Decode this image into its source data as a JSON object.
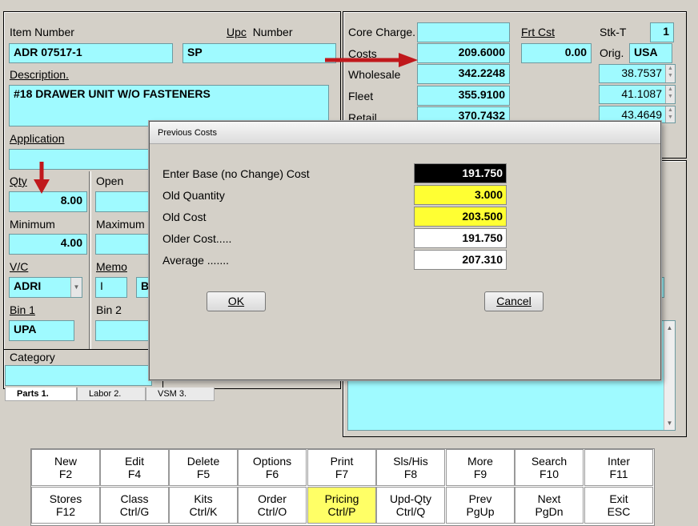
{
  "form": {
    "item_number_label": "Item Number",
    "item_number": "ADR 07517-1",
    "upc_label_a": "Upc",
    "upc_label_b": "Number",
    "upc": "SP",
    "description_label": "Description.",
    "description": "#18 DRAWER UNIT W/O FASTENERS",
    "application_label": "Application",
    "qty_label": "Qty",
    "qty": "8.00",
    "open_label": "Open",
    "minimum_label": "Minimum",
    "minimum": "4.00",
    "maximum_label": "Maximum",
    "vc_label": "V/C",
    "vc": "ADRI",
    "memo_label": "Memo",
    "memo": "I",
    "memo_b": "B",
    "bin1_label": "Bin 1",
    "bin1": "UPA",
    "bin2_label": "Bin 2",
    "category_label": "Category"
  },
  "pricing": {
    "core_charge_label": "Core Charge.",
    "costs_label": "Costs",
    "costs": "209.6000",
    "wholesale_label": "Wholesale",
    "wholesale": "342.2248",
    "fleet_label": "Fleet",
    "fleet": "355.9100",
    "retail_label": "Retail",
    "retail": "370.7432",
    "frt_cst_label": "Frt Cst",
    "frt_cst": "0.00",
    "stkt_label": "Stk-T",
    "stkt": "1",
    "orig_label": "Orig.",
    "orig": "USA",
    "pct1": "38.7537",
    "pct2": "41.1087",
    "pct3": "43.4649"
  },
  "tabs": [
    "Parts 1.",
    "Labor 2.",
    "VSM 3."
  ],
  "dialog": {
    "title": "Previous Costs",
    "rows": [
      {
        "label": "Enter Base (no Change) Cost",
        "value": "191.750"
      },
      {
        "label": "Old Quantity",
        "value": "3.000"
      },
      {
        "label": "Old Cost",
        "value": "203.500"
      },
      {
        "label": "Older Cost.....",
        "value": "191.750"
      },
      {
        "label": "Average .......",
        "value": "207.310"
      }
    ],
    "ok": "OK",
    "cancel": "Cancel"
  },
  "fkeys_row1": [
    {
      "label": "New",
      "key": "F2"
    },
    {
      "label": "Edit",
      "key": "F4"
    },
    {
      "label": "Delete",
      "key": "F5"
    },
    {
      "label": "Options",
      "key": "F6"
    },
    {
      "label": "Print",
      "key": "F7"
    },
    {
      "label": "Sls/His",
      "key": "F8"
    },
    {
      "label": "More",
      "key": "F9"
    },
    {
      "label": "Search",
      "key": "F10"
    },
    {
      "label": "Inter",
      "key": "F11"
    }
  ],
  "fkeys_row2": [
    {
      "label": "Stores",
      "key": "F12"
    },
    {
      "label": "Class",
      "key": "Ctrl/G"
    },
    {
      "label": "Kits",
      "key": "Ctrl/K"
    },
    {
      "label": "Order",
      "key": "Ctrl/O"
    },
    {
      "label": "Pricing",
      "key": "Ctrl/P"
    },
    {
      "label": "Upd-Qty",
      "key": "Ctrl/Q"
    },
    {
      "label": "Prev",
      "key": "PgUp"
    },
    {
      "label": "Next",
      "key": "PgDn"
    },
    {
      "label": "Exit",
      "key": "ESC"
    }
  ],
  "colors": {
    "field": "#9ffaff",
    "highlight": "#ffff33",
    "arrow": "#c0181c"
  }
}
